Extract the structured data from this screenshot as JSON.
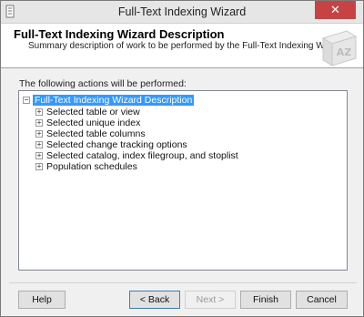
{
  "window": {
    "title": "Full-Text Indexing Wizard",
    "close_glyph": "✕"
  },
  "header": {
    "title": "Full-Text Indexing Wizard Description",
    "subtitle": "Summary description of work to be performed by the Full-Text Indexing Wizard.",
    "art_text": "AZ"
  },
  "main": {
    "prompt": "The following actions will be performed:",
    "tree": {
      "root": {
        "label": "Full-Text Indexing Wizard Description",
        "expander": "−"
      },
      "items": [
        {
          "label": "Selected table or view",
          "expander": "+"
        },
        {
          "label": "Selected unique index",
          "expander": "+"
        },
        {
          "label": "Selected table columns",
          "expander": "+"
        },
        {
          "label": "Selected change tracking options",
          "expander": "+"
        },
        {
          "label": "Selected catalog, index filegroup, and stoplist",
          "expander": "+"
        },
        {
          "label": "Population schedules",
          "expander": "+"
        }
      ]
    }
  },
  "buttons": {
    "help": "Help",
    "back": "< Back",
    "next": "Next >",
    "finish": "Finish",
    "cancel": "Cancel"
  },
  "colors": {
    "close": "#c74343",
    "selection": "#3399ff"
  }
}
